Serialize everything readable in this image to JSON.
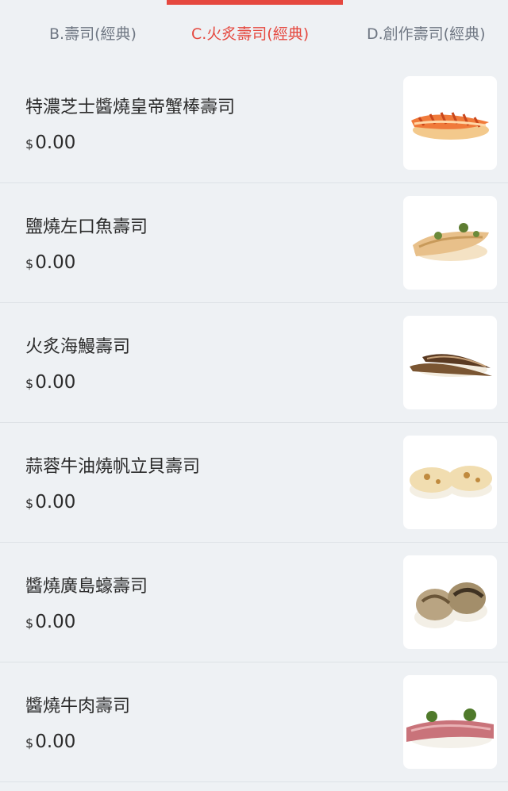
{
  "tabs": [
    {
      "label": "B.壽司(經典)",
      "active": false
    },
    {
      "label": "C.火炙壽司(經典)",
      "active": true
    },
    {
      "label": "D.創作壽司(經典)",
      "active": false
    }
  ],
  "items": [
    {
      "name": "特濃芝士醬燒皇帝蟹棒壽司",
      "currency": "$",
      "price": "0.00",
      "image": "crab-stick-sushi"
    },
    {
      "name": "鹽燒左口魚壽司",
      "currency": "$",
      "price": "0.00",
      "image": "flounder-sushi"
    },
    {
      "name": "火炙海鰻壽司",
      "currency": "$",
      "price": "0.00",
      "image": "eel-sushi"
    },
    {
      "name": "蒜蓉牛油燒帆立貝壽司",
      "currency": "$",
      "price": "0.00",
      "image": "scallop-sushi"
    },
    {
      "name": "醬燒廣島蠔壽司",
      "currency": "$",
      "price": "0.00",
      "image": "oyster-sushi"
    },
    {
      "name": "醬燒牛肉壽司",
      "currency": "$",
      "price": "0.00",
      "image": "beef-sushi"
    }
  ],
  "colors": {
    "accent": "#e5483f",
    "background": "#eef1f4",
    "inactive_tab": "#6f7783"
  }
}
